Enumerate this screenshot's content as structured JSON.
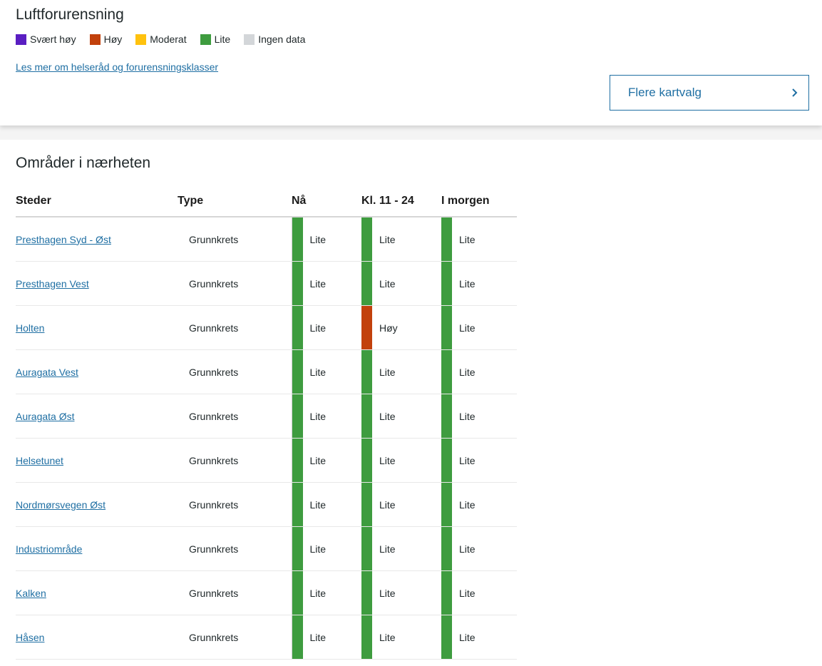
{
  "header": {
    "title": "Luftforurensning",
    "legend": [
      {
        "label": "Svært høy",
        "color": "#5a1ec2"
      },
      {
        "label": "Høy",
        "color": "#c2410c"
      },
      {
        "label": "Moderat",
        "color": "#ffc20e"
      },
      {
        "label": "Lite",
        "color": "#3e9c3f"
      },
      {
        "label": "Ingen data",
        "color": "#d3d6d9"
      }
    ],
    "info_link": "Les mer om helseråd og forurensningsklasser",
    "more_button": "Flere kartvalg"
  },
  "nearby": {
    "title": "Områder i nærheten",
    "columns": [
      "Steder",
      "Type",
      "Nå",
      "Kl. 11 - 24",
      "I morgen"
    ],
    "rows": [
      {
        "place": "Presthagen Syd - Øst",
        "type": "Grunnkrets",
        "now": "Lite",
        "later": "Lite",
        "tomorrow": "Lite"
      },
      {
        "place": "Presthagen Vest",
        "type": "Grunnkrets",
        "now": "Lite",
        "later": "Lite",
        "tomorrow": "Lite"
      },
      {
        "place": "Holten",
        "type": "Grunnkrets",
        "now": "Lite",
        "later": "Høy",
        "tomorrow": "Lite"
      },
      {
        "place": "Auragata Vest",
        "type": "Grunnkrets",
        "now": "Lite",
        "later": "Lite",
        "tomorrow": "Lite"
      },
      {
        "place": "Auragata Øst",
        "type": "Grunnkrets",
        "now": "Lite",
        "later": "Lite",
        "tomorrow": "Lite"
      },
      {
        "place": "Helsetunet",
        "type": "Grunnkrets",
        "now": "Lite",
        "later": "Lite",
        "tomorrow": "Lite"
      },
      {
        "place": "Nordmørsvegen Øst",
        "type": "Grunnkrets",
        "now": "Lite",
        "later": "Lite",
        "tomorrow": "Lite"
      },
      {
        "place": "Industriområde",
        "type": "Grunnkrets",
        "now": "Lite",
        "later": "Lite",
        "tomorrow": "Lite"
      },
      {
        "place": "Kalken",
        "type": "Grunnkrets",
        "now": "Lite",
        "later": "Lite",
        "tomorrow": "Lite"
      },
      {
        "place": "Håsen",
        "type": "Grunnkrets",
        "now": "Lite",
        "later": "Lite",
        "tomorrow": "Lite"
      }
    ]
  }
}
